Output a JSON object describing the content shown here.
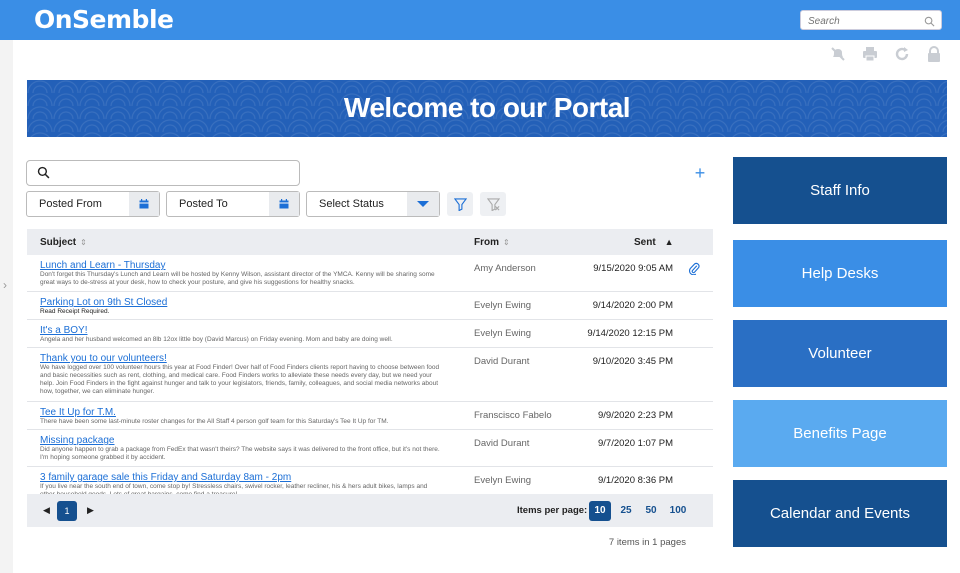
{
  "app": {
    "logo": "OnSemble"
  },
  "header": {
    "search_placeholder": "Search"
  },
  "banner": {
    "title": "Welcome to our Portal"
  },
  "filters": {
    "posted_from": "Posted From",
    "posted_to": "Posted To",
    "status": "Select Status"
  },
  "table": {
    "columns": {
      "subject": "Subject",
      "from": "From",
      "sent": "Sent"
    },
    "rows": [
      {
        "subject": "Lunch and Learn - Thursday",
        "preview": "Don't forget this Thursday's Lunch and Learn will be hosted by Kenny Wilson, assistant director of the YMCA. Kenny will be sharing some great ways to de-stress at your desk, how to check your posture, and give his suggestions for healthy snacks.",
        "from": "Amy Anderson",
        "sent": "9/15/2020 9:05 AM",
        "attachment": true
      },
      {
        "subject": "Parking Lot on 9th St Closed",
        "preview": "Read Receipt Required.",
        "from": "Evelyn Ewing",
        "sent": "9/14/2020  2:00 PM",
        "attachment": false
      },
      {
        "subject": "It's a BOY!",
        "preview": "Angela and her husband welcomed an 8lb 12ox little boy (David Marcus) on Friday evening. Mom and baby are doing well.",
        "from": "Evelyn Ewing",
        "sent": "9/14/2020 12:15 PM",
        "attachment": false
      },
      {
        "subject": "Thank you to our volunteers!",
        "preview": "We have logged over 100 volunteer hours this year at Food Finder! Over half of Food Finders clients report having to choose between food and basic necessities such as rent, clothing, and medical care. Food Finders works to alleviate these needs every day, but we need your help. Join Food Finders in the fight against hunger and talk to your legislators, friends, family, colleagues, and social media networks about how, together, we can eliminate hunger.",
        "from": "David Durant",
        "sent": "9/10/2020 3:45 PM",
        "attachment": false
      },
      {
        "subject": "Tee It Up for T.M.",
        "preview": "There have been some last-minute roster changes for the All Staff 4 person golf team for this Saturday's Tee It Up for TM.",
        "from": "Franscisco Fabelo",
        "sent": "9/9/2020 2:23 PM",
        "attachment": false
      },
      {
        "subject": "Missing package",
        "preview": "Did anyone happen to grab a package from FedEx that wasn't theirs? The website says it was delivered to the front office, but it's not there. I'm hoping someone grabbed it by accident.",
        "from": "David Durant",
        "sent": "9/7/2020 1:07 PM",
        "attachment": false
      },
      {
        "subject": "3 family garage sale this Friday and Saturday 8am - 2pm",
        "preview": "If you live near the south end of town, come stop by! Stressless chairs, swivel rocker, leather recliner, his & hers adult bikes, lamps and other household goods. Lots of great bargains, come find a treasure!",
        "from": "Evelyn Ewing",
        "sent": "9/1/2020 8:36 PM",
        "attachment": false
      }
    ]
  },
  "pagination": {
    "current_page": "1",
    "items_per_page_label": "Items per page:",
    "options": [
      "10",
      "25",
      "50",
      "100"
    ],
    "selected": "10",
    "summary": "7 items in 1 pages"
  },
  "sidebar": {
    "links": [
      {
        "label": "Staff Info",
        "color": "#15508f"
      },
      {
        "label": "Help Desks",
        "color": "#3a8ee6"
      },
      {
        "label": "Volunteer",
        "color": "#2a6fc4"
      },
      {
        "label": "Benefits Page",
        "color": "#5aaaf0"
      },
      {
        "label": "Calendar and Events",
        "color": "#15508f"
      }
    ]
  },
  "colors": {
    "accent": "#3a8ee6",
    "dark": "#15508f"
  }
}
